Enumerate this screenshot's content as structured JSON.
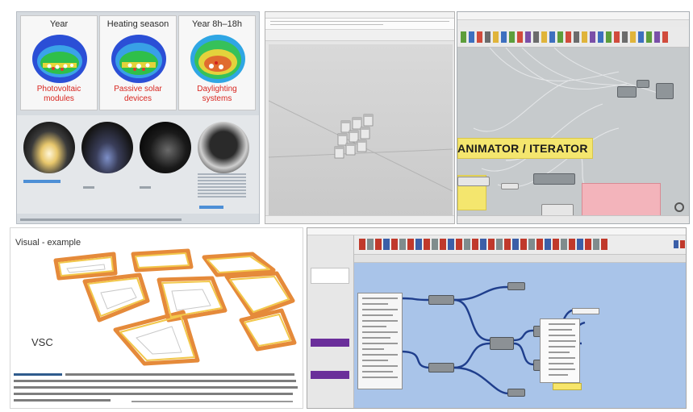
{
  "sky_domes": [
    {
      "title": "Year",
      "caption_line1": "Photovoltaic",
      "caption_line2": "modules"
    },
    {
      "title": "Heating season",
      "caption_line1": "Passive solar",
      "caption_line2": "devices"
    },
    {
      "title": "Year 8h–18h",
      "caption_line1": "Daylighting",
      "caption_line2": "systems"
    }
  ],
  "animator": {
    "title": "ANIMATOR / ITERATOR"
  },
  "vsc_example": {
    "title": "Visual - example",
    "label": "VSC"
  },
  "colors": {
    "caption_red": "#d8251f",
    "gh_yellow_group": "#f4e66e",
    "gh_pink_group": "#f3b4bb",
    "gh_canvas_blue": "#a9c4e9",
    "wire_dark_blue": "#1f3e8c",
    "ring_orange": "#e58a3a",
    "ring_yellow": "#f2c84b",
    "purple_accent": "#6a2e9a"
  },
  "icons": [
    "sky-dome-heatmap",
    "render-sphere",
    "extruded-box",
    "gh-component",
    "navigation-icon"
  ]
}
